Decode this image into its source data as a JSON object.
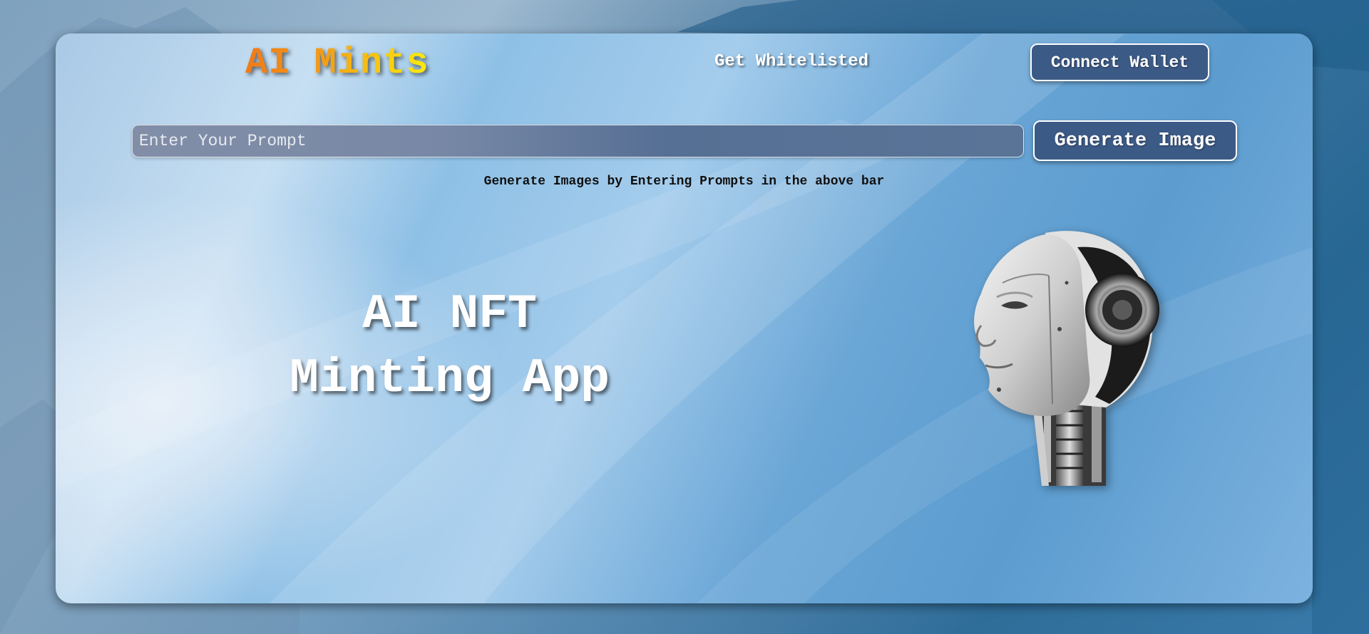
{
  "header": {
    "logo_text": "AI Mints",
    "nav_link": "Get Whitelisted",
    "connect_button": "Connect Wallet"
  },
  "prompt": {
    "placeholder": "Enter Your Prompt",
    "value": "",
    "generate_button": "Generate Image",
    "hint": "Generate Images by Entering Prompts in the above bar"
  },
  "hero": {
    "title_line1": "AI NFT",
    "title_line2": "Minting App",
    "image_icon": "robot-head-icon"
  },
  "colors": {
    "button_bg": "#3c5a86",
    "logo_gradient_start": "#f07a18",
    "logo_gradient_end": "#f8ec10"
  }
}
